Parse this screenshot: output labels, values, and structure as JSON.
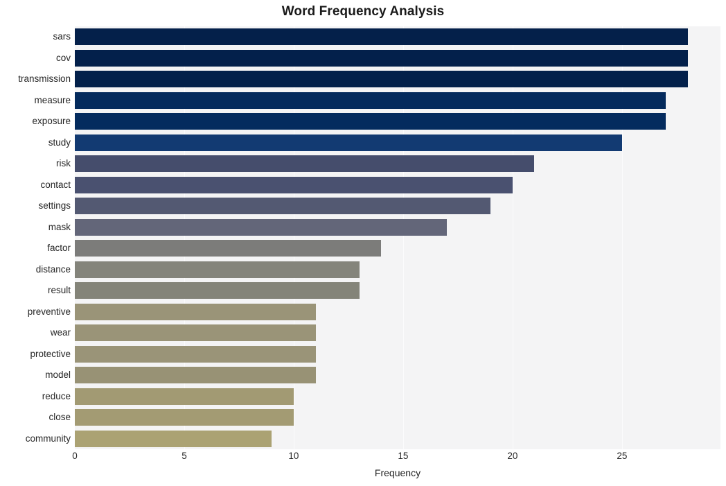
{
  "chart_data": {
    "type": "bar",
    "orientation": "horizontal",
    "title": "Word Frequency Analysis",
    "xlabel": "Frequency",
    "ylabel": "",
    "categories": [
      "sars",
      "cov",
      "transmission",
      "measure",
      "exposure",
      "study",
      "risk",
      "contact",
      "settings",
      "mask",
      "factor",
      "distance",
      "result",
      "preventive",
      "wear",
      "protective",
      "model",
      "reduce",
      "close",
      "community"
    ],
    "values": [
      28,
      28,
      28,
      27,
      27,
      25,
      21,
      20,
      19,
      17,
      14,
      13,
      13,
      11,
      11,
      11,
      11,
      10,
      10,
      9
    ],
    "bar_colors": [
      "#04204a",
      "#03204b",
      "#03204a",
      "#042a5c",
      "#042b5e",
      "#123a72",
      "#454d6c",
      "#4a5170",
      "#535972",
      "#636679",
      "#7c7c7a",
      "#84847b",
      "#848479",
      "#9a9478",
      "#9a9478",
      "#9a9478",
      "#989275",
      "#a29a73",
      "#a39b73",
      "#ab a273"
    ],
    "xticks": [
      0,
      5,
      10,
      15,
      20,
      25
    ],
    "xlim": [
      0,
      29.5
    ],
    "grid": true,
    "grid_color": "#fbfbfc",
    "plot_background": "#f4f4f5",
    "figure_background": "#ffffff",
    "legend": null
  },
  "axis": {
    "x_tick_labels": [
      "0",
      "5",
      "10",
      "15",
      "20",
      "25"
    ]
  }
}
